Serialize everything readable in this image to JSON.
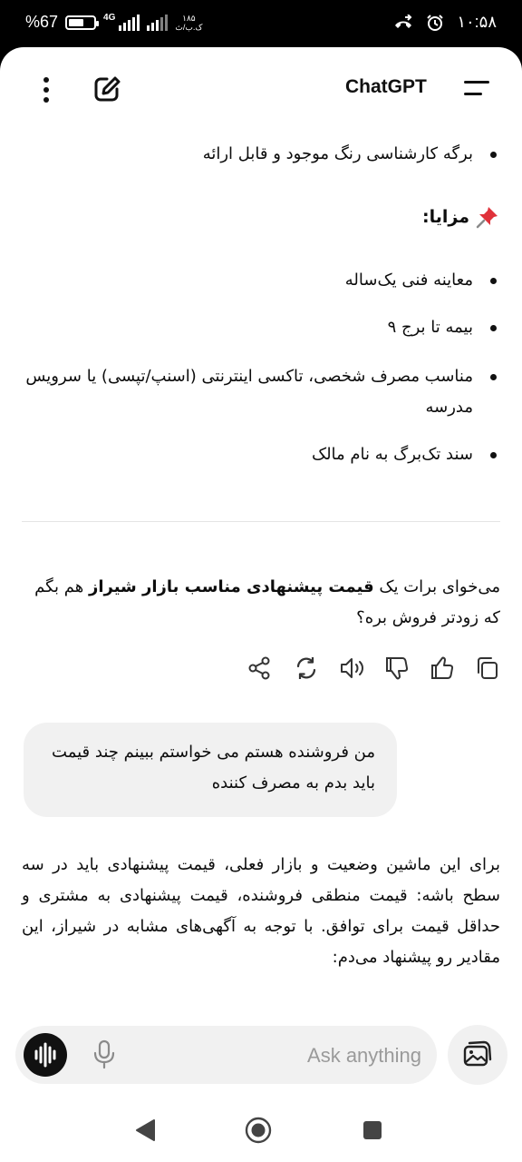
{
  "status_bar": {
    "battery": "%67",
    "battery_level": 0.67,
    "network": "4G",
    "speed_value": "۱۸۵",
    "speed_unit": "ک.ب/ث",
    "time": "۱۰:۵۸"
  },
  "header": {
    "title": "ChatGPT"
  },
  "conversation": {
    "bullet_top": "برگه کارشناسی رنگ موجود و قابل ارائه",
    "advantages_heading": "مزایا:",
    "advantages": [
      "معاینه فنی یک‌ساله",
      "بیمه تا برج ۹",
      "مناسب مصرف شخصی، تاکسی اینترنتی (اسنپ/تپسی) یا سرویس مدرسه",
      "سند تک‌برگ به نام مالک"
    ],
    "question_part1": "می‌خوای برات یک ",
    "question_bold": "قیمت پیشنهادی مناسب بازار شیراز",
    "question_part2": " هم بگم که زودتر فروش بره؟",
    "user_message": "من فروشنده هستم می خواستم ببینم چند قیمت باید بدم به مصرف کننده",
    "assistant_reply": "برای این ماشین وضعیت و بازار فعلی، قیمت پیشنهادی باید در سه سطح باشه: قیمت منطقی فروشنده، قیمت پیشنهادی به مشتری و حداقل قیمت برای توافق. با توجه به آگهی‌های مشابه در شیراز، این مقادیر رو پیشنهاد می‌دم:"
  },
  "composer": {
    "placeholder": "Ask anything"
  },
  "icons": {
    "pin": "pushpin-icon",
    "actions": [
      "share-icon",
      "regenerate-icon",
      "read-aloud-icon",
      "thumbs-down-icon",
      "thumbs-up-icon",
      "copy-icon"
    ]
  },
  "colors": {
    "background": "#ffffff",
    "text": "#0d0d0d",
    "bubble": "#f1f1f1",
    "status_bar": "#000000"
  }
}
